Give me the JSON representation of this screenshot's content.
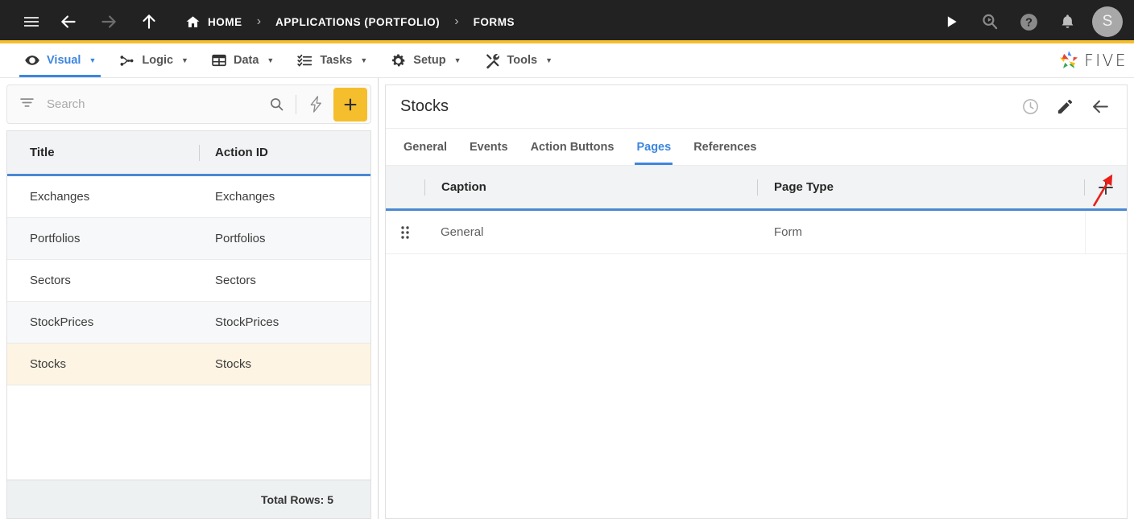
{
  "topbar": {
    "icons": {
      "menu": "hamburger-icon",
      "back": "arrow-left-icon",
      "forward": "arrow-right-icon",
      "up": "arrow-up-icon",
      "home": "home-icon",
      "run": "play-icon",
      "search": "search-magnify-icon",
      "help": "help-circle-icon",
      "notifications": "bell-icon"
    },
    "breadcrumb": [
      {
        "label": "HOME",
        "icon": "home-icon"
      },
      {
        "label": "APPLICATIONS (PORTFOLIO)"
      },
      {
        "label": "FORMS"
      }
    ],
    "separator": "›",
    "avatar_initial": "S"
  },
  "menubar": {
    "items": [
      {
        "label": "Visual",
        "icon": "eye-icon",
        "active": true
      },
      {
        "label": "Logic",
        "icon": "nodes-icon",
        "active": false
      },
      {
        "label": "Data",
        "icon": "table-icon",
        "active": false
      },
      {
        "label": "Tasks",
        "icon": "checklist-icon",
        "active": false
      },
      {
        "label": "Setup",
        "icon": "gear-icon",
        "active": false
      },
      {
        "label": "Tools",
        "icon": "tools-icon",
        "active": false
      }
    ],
    "caret": "▼",
    "brand": "FIVE"
  },
  "left_panel": {
    "search": {
      "placeholder": "Search",
      "value": "",
      "filter_icon": "filter-icon",
      "search_icon": "search-icon",
      "lightning_icon": "lightning-bolt-icon",
      "add_label": "+"
    },
    "columns": [
      "Title",
      "Action ID"
    ],
    "rows": [
      {
        "title": "Exchanges",
        "action_id": "Exchanges"
      },
      {
        "title": "Portfolios",
        "action_id": "Portfolios"
      },
      {
        "title": "Sectors",
        "action_id": "Sectors"
      },
      {
        "title": "StockPrices",
        "action_id": "StockPrices"
      },
      {
        "title": "Stocks",
        "action_id": "Stocks"
      }
    ],
    "selected_index": 4,
    "footer": "Total Rows: 5"
  },
  "right_panel": {
    "title": "Stocks",
    "actions": [
      {
        "name": "history-clock-icon"
      },
      {
        "name": "edit-pencil-icon"
      },
      {
        "name": "back-arrow-icon"
      }
    ],
    "tabs": [
      {
        "label": "General",
        "active": false
      },
      {
        "label": "Events",
        "active": false
      },
      {
        "label": "Action Buttons",
        "active": false
      },
      {
        "label": "Pages",
        "active": true
      },
      {
        "label": "References",
        "active": false
      }
    ],
    "pages_grid": {
      "columns": [
        "Caption",
        "Page Type"
      ],
      "add_label": "+",
      "rows": [
        {
          "caption": "General",
          "page_type": "Form"
        }
      ]
    }
  },
  "colors": {
    "topbar_bg": "#222222",
    "accent_gold": "#F5BE2C",
    "active_blue": "#3d86e0",
    "grid_underline": "#4a89d4",
    "selected_row": "#FDF4E3",
    "annotation_red": "#e8201a"
  }
}
